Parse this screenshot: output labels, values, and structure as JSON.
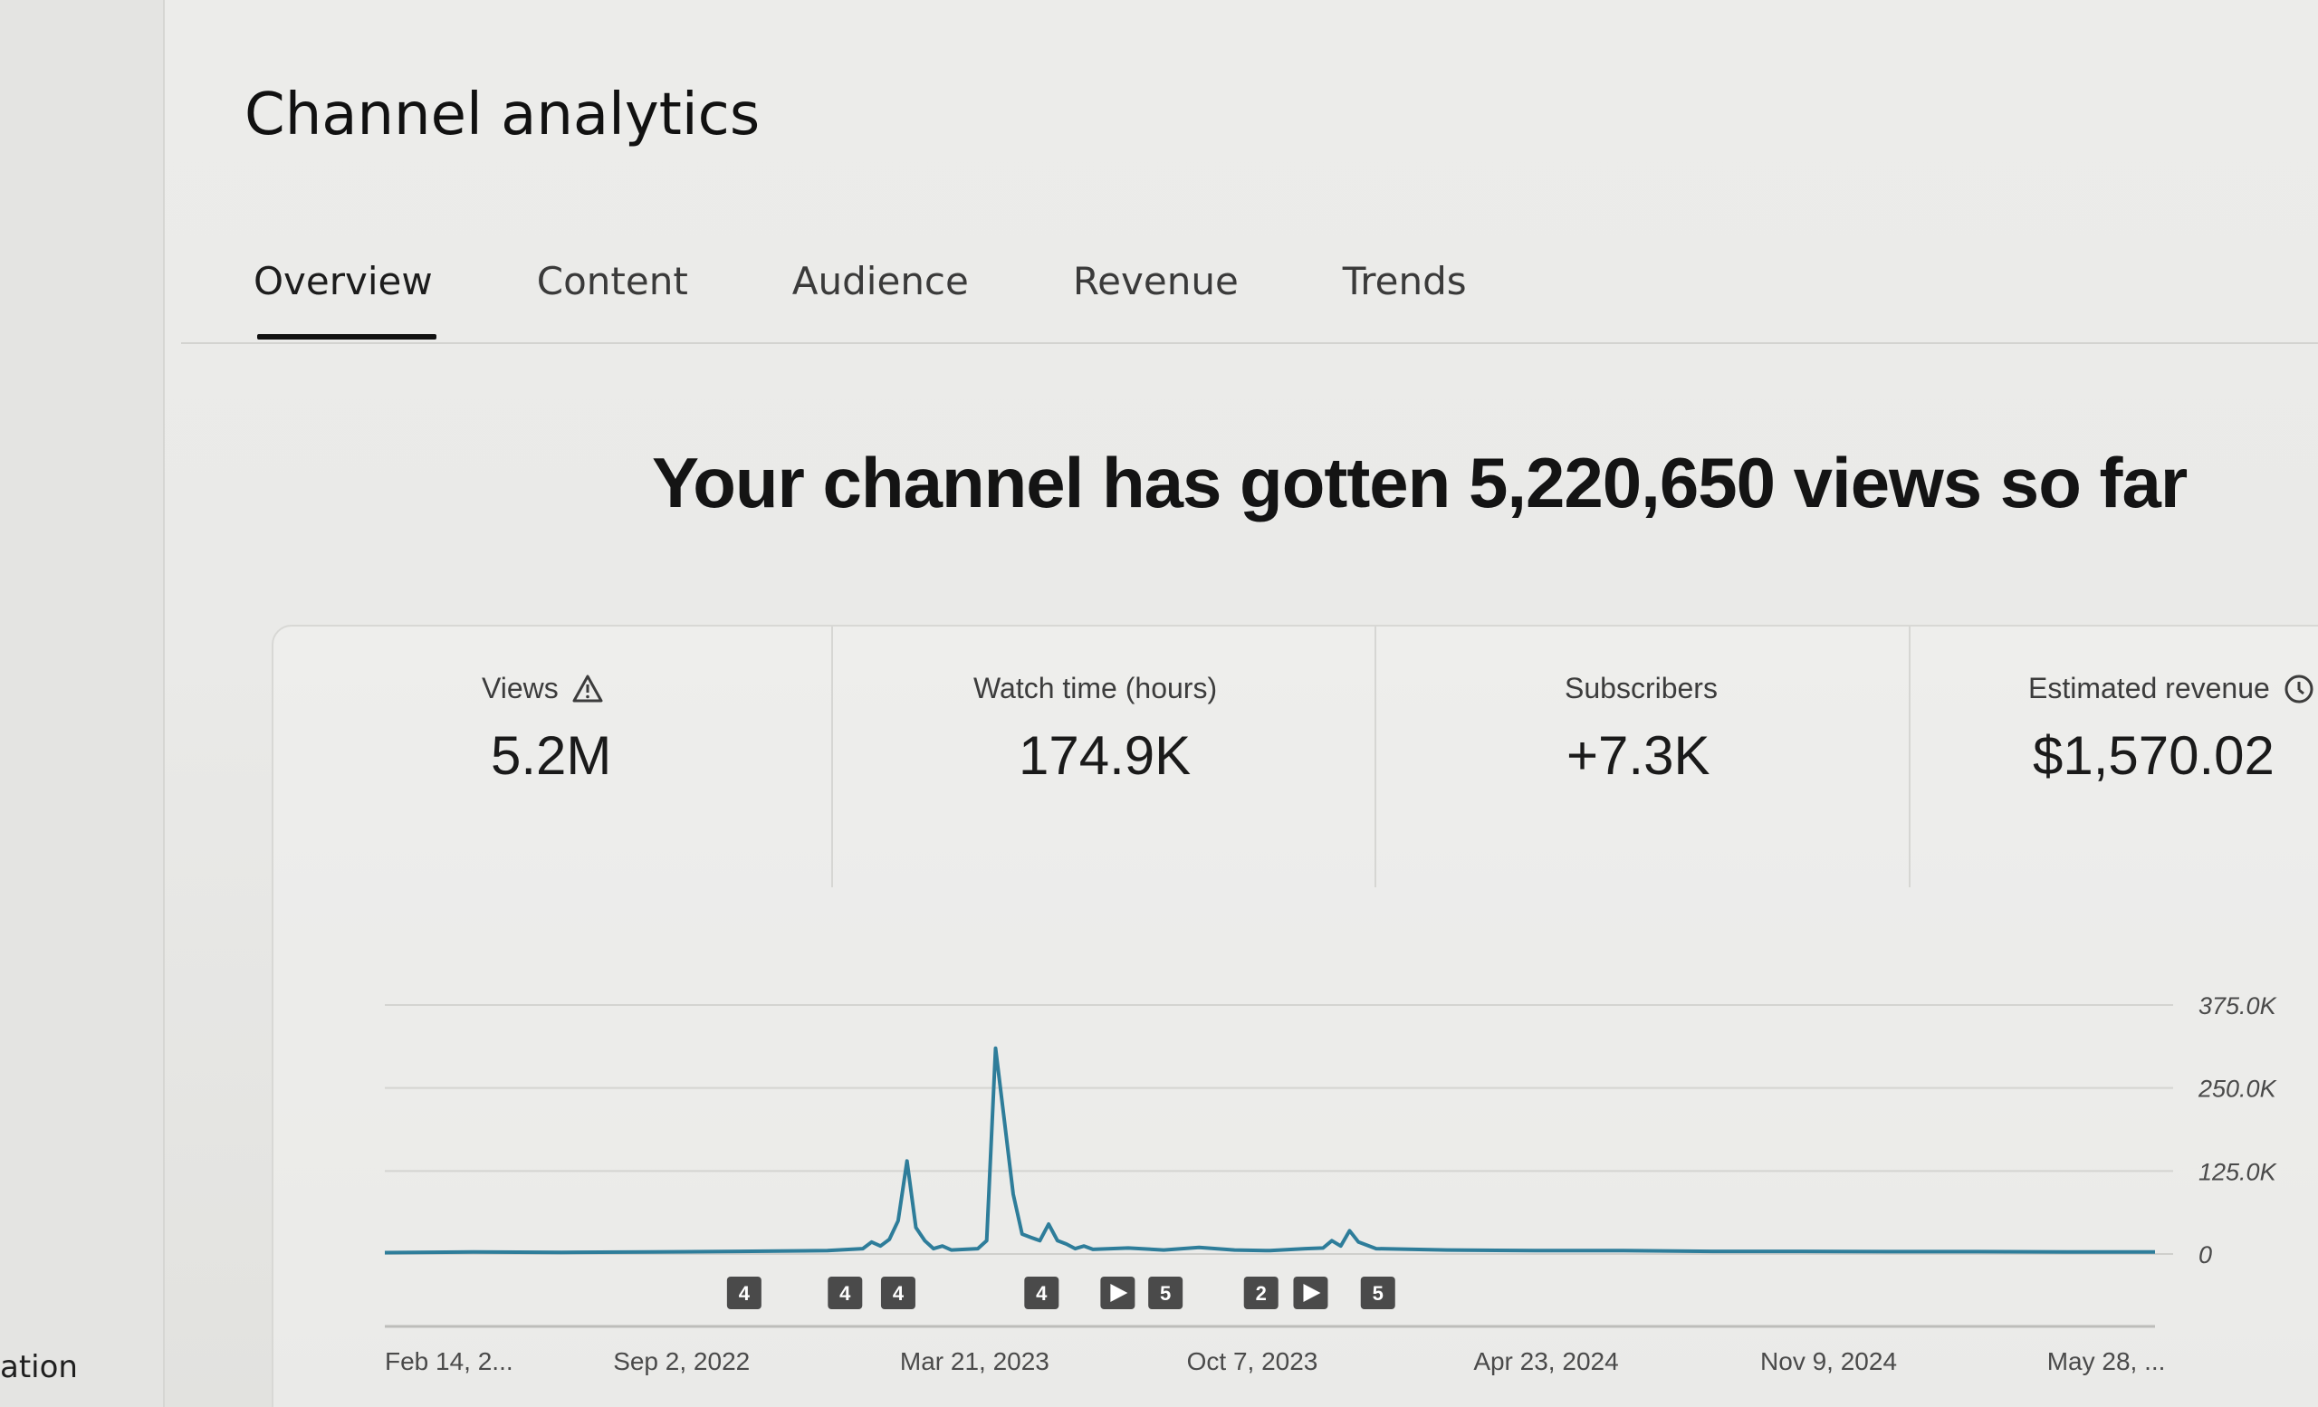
{
  "sidebar": {
    "partial_label": "ation"
  },
  "page": {
    "title": "Channel analytics"
  },
  "tabs": [
    {
      "label": "Overview",
      "active": true
    },
    {
      "label": "Content",
      "active": false
    },
    {
      "label": "Audience",
      "active": false
    },
    {
      "label": "Revenue",
      "active": false
    },
    {
      "label": "Trends",
      "active": false
    }
  ],
  "headline": "Your channel has gotten 5,220,650 views so far",
  "metrics": [
    {
      "label": "Views",
      "value": "5.2M",
      "icon": "warning-icon"
    },
    {
      "label": "Watch time (hours)",
      "value": "174.9K",
      "icon": ""
    },
    {
      "label": "Subscribers",
      "value": "+7.3K",
      "icon": ""
    },
    {
      "label": "Estimated revenue",
      "value": "$1,570.02",
      "icon": "clock-icon"
    }
  ],
  "colors": {
    "line": "#2e7d9a",
    "grid": "#d4d4d1",
    "marker": "#4a4a4a"
  },
  "chart_data": {
    "type": "line",
    "ylim": [
      0,
      375000
    ],
    "y_ticks": [
      "375.0K",
      "250.0K",
      "125.0K",
      "0"
    ],
    "y_tick_values": [
      375000,
      250000,
      125000,
      0
    ],
    "x_tick_labels": [
      "Feb 14, 2...",
      "Sep 2, 2022",
      "Mar 21, 2023",
      "Oct 7, 2023",
      "Apr 23, 2024",
      "Nov 9, 2024",
      "May 28, ..."
    ],
    "x_tick_positions": [
      0,
      0.129,
      0.291,
      0.453,
      0.615,
      0.777,
      0.939
    ],
    "grid": true,
    "series": [
      {
        "x": [
          0,
          0.05,
          0.1,
          0.15,
          0.2,
          0.25,
          0.27,
          0.275,
          0.28,
          0.285,
          0.29,
          0.295,
          0.3,
          0.305,
          0.31,
          0.315,
          0.32,
          0.335,
          0.34,
          0.345,
          0.35,
          0.355,
          0.36,
          0.365,
          0.37,
          0.375,
          0.38,
          0.385,
          0.39,
          0.395,
          0.4,
          0.42,
          0.44,
          0.46,
          0.48,
          0.5,
          0.52,
          0.53,
          0.535,
          0.54,
          0.545,
          0.55,
          0.56,
          0.6,
          0.65,
          0.7,
          0.75,
          0.8,
          0.85,
          0.9,
          0.95,
          1.0
        ],
        "y": [
          2000,
          3000,
          2500,
          3000,
          4000,
          5000,
          8000,
          18000,
          12000,
          22000,
          50000,
          140000,
          40000,
          20000,
          8000,
          12000,
          6000,
          8000,
          20000,
          310000,
          200000,
          90000,
          30000,
          25000,
          20000,
          45000,
          20000,
          15000,
          8000,
          12000,
          7000,
          9000,
          6000,
          10000,
          6000,
          5000,
          8000,
          9000,
          20000,
          12000,
          35000,
          18000,
          8000,
          6000,
          5000,
          5000,
          4000,
          4000,
          3500,
          3500,
          3000,
          3000
        ]
      }
    ],
    "annotations": [
      {
        "x": 0.203,
        "label": "4",
        "kind": "number"
      },
      {
        "x": 0.26,
        "label": "4",
        "kind": "number"
      },
      {
        "x": 0.29,
        "label": "4",
        "kind": "number"
      },
      {
        "x": 0.371,
        "label": "4",
        "kind": "number"
      },
      {
        "x": 0.414,
        "label": "",
        "kind": "play"
      },
      {
        "x": 0.441,
        "label": "5",
        "kind": "number"
      },
      {
        "x": 0.495,
        "label": "2",
        "kind": "number"
      },
      {
        "x": 0.523,
        "label": "",
        "kind": "play"
      },
      {
        "x": 0.561,
        "label": "5",
        "kind": "number"
      }
    ]
  }
}
